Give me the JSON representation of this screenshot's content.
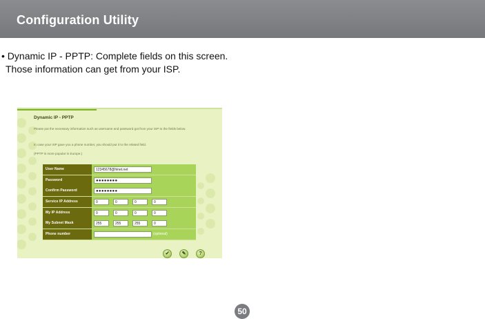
{
  "header": {
    "title": "Configuration Utility"
  },
  "intro": {
    "line1": "• Dynamic IP - PPTP: Complete fields on this screen.",
    "line2": "Those information can get from your ISP."
  },
  "screenshot": {
    "title": "Dynamic IP - PPTP",
    "para1": "Please put the necessary information such as username and password got from your ISP to the fields below.",
    "para2": "In case your ISP gave you a phone number, you should put it to the related field.",
    "para3": "(PPTP is more popular in Europe.)",
    "fields": [
      {
        "label": "User Name",
        "value": "12345678@hinet.net"
      },
      {
        "label": "Password",
        "value": "●●●●●●●●"
      },
      {
        "label": "Confirm Password",
        "value": "●●●●●●●●"
      },
      {
        "label": "Service IP Address",
        "octets": [
          "0",
          "0",
          "0",
          "0"
        ]
      },
      {
        "label": "My IP Address",
        "octets": [
          "0",
          "0",
          "0",
          "0"
        ]
      },
      {
        "label": "My Subnet Mask",
        "octets": [
          "255",
          "255",
          "255",
          "0"
        ]
      },
      {
        "label": "Phone number",
        "value": "",
        "note": "(optional)"
      }
    ],
    "buttons": {
      "ok": "✔",
      "cancel": "✎",
      "help": "?"
    }
  },
  "page_number": "50"
}
